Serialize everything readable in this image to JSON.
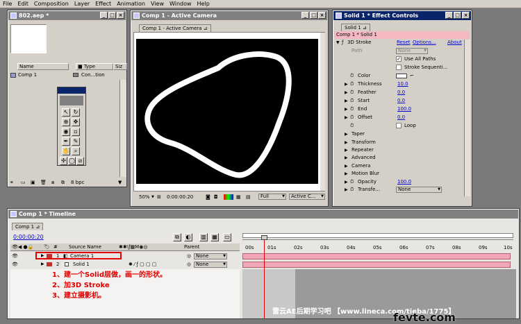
{
  "menu": [
    "File",
    "Edit",
    "Composition",
    "Layer",
    "Effect",
    "Animation",
    "View",
    "Window",
    "Help"
  ],
  "project": {
    "title": "802.aep *",
    "columns": [
      "Name",
      "Type",
      "Siz"
    ],
    "item_name": "Comp 1",
    "item_type": "Con...tion",
    "bpc": "8 bpc"
  },
  "comp": {
    "title": "Comp 1 - Active Camera",
    "tab": "Comp 1 - Active Camera",
    "zoom": "50%",
    "timecode": "0:00:00:20",
    "resolution": "Full",
    "camera": "Active C..."
  },
  "effects": {
    "title": "Solid 1 * Effect Controls",
    "tab": "Solid 1",
    "header": "Comp 1 * Solid 1",
    "effect_name": "3D Stroke",
    "reset": "Reset",
    "options": "Options...",
    "about": "About",
    "path_label": "Path",
    "path_value": "None",
    "use_all_paths": "Use All Paths",
    "stroke_sequentially": "Stroke Sequenti...",
    "params": [
      {
        "label": "Color"
      },
      {
        "label": "Thickness",
        "value": "10.0"
      },
      {
        "label": "Feather",
        "value": "0.0"
      },
      {
        "label": "Start",
        "value": "0.0"
      },
      {
        "label": "End",
        "value": "100.0"
      },
      {
        "label": "Offset",
        "value": "0.0"
      }
    ],
    "loop": "Loop",
    "groups": [
      "Taper",
      "Transform",
      "Repeater",
      "Advanced",
      "Camera",
      "Motion Blur"
    ],
    "opacity_label": "Opacity",
    "opacity_value": "100.0",
    "transfer_label": "Transfe...",
    "transfer_value": "None"
  },
  "timeline": {
    "title": "Comp 1 * Timeline",
    "tab": "Comp 1",
    "timecode": "0:00:00:20",
    "source_name": "Source Name",
    "parent": "Parent",
    "ruler": [
      "00s",
      "01s",
      "02s",
      "03s",
      "04s",
      "05s",
      "06s",
      "07s",
      "08s",
      "09s",
      "10s"
    ],
    "layers": [
      {
        "num": "1",
        "name": "Camera 1",
        "parent": "None"
      },
      {
        "num": "2",
        "name": "Solid 1",
        "parent": "None"
      }
    ],
    "playhead_fraction": 0.068
  },
  "notes": [
    "1、建一个Solid层做，画一的形状。",
    "2、加3D Stroke",
    "3、建立摄影机。"
  ],
  "watermark": "雷云AE后期学习吧 【www.lineca.com/tieba/1775】",
  "watermark2": "fevte.com",
  "colors": {
    "accent": "#0a246a",
    "effect_header": "#f4b8c0",
    "track": "#f0a8b8",
    "note": "#e00000"
  }
}
